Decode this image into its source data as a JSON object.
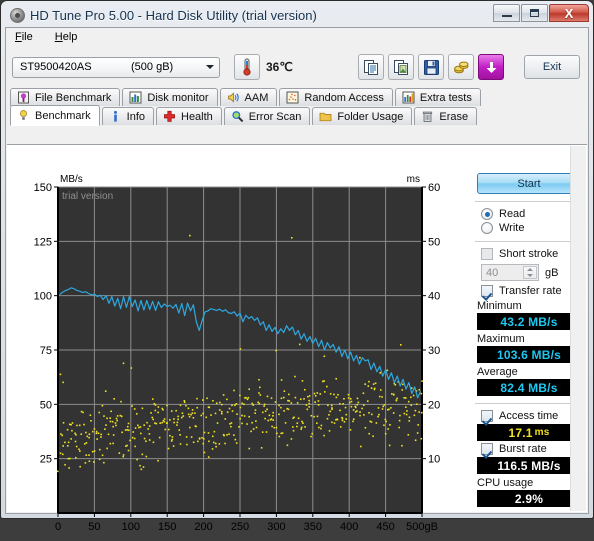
{
  "window": {
    "title": "HD Tune Pro 5.00 - Hard Disk Utility (trial version)",
    "icon": "hdd-icon",
    "minimize_label": "Minimize",
    "maximize_label": "Maximize",
    "close_label": "X"
  },
  "menu": {
    "items": [
      {
        "label": "File",
        "mnemonic": "F"
      },
      {
        "label": "Help",
        "mnemonic": "H"
      }
    ]
  },
  "toolbar": {
    "drive_model": "ST9500420AS",
    "drive_capacity": "(500 gB)",
    "temperature": "36℃",
    "temp_icon": "thermometer-icon",
    "buttons": [
      {
        "name": "copy-button",
        "icon": "copy-icon"
      },
      {
        "name": "copy-image-button",
        "icon": "copy-image-icon"
      },
      {
        "name": "save-button",
        "icon": "floppy-save-icon"
      },
      {
        "name": "options-button",
        "icon": "gold-coins-icon"
      },
      {
        "name": "download-button",
        "icon": "download-arrow-icon"
      }
    ],
    "exit_label": "Exit"
  },
  "tabs": {
    "row1": [
      {
        "label": "File Benchmark",
        "icon": "file-benchmark-icon",
        "active": false
      },
      {
        "label": "Disk monitor",
        "icon": "bar-chart-icon",
        "active": false
      },
      {
        "label": "AAM",
        "icon": "speaker-icon",
        "active": false
      },
      {
        "label": "Random Access",
        "icon": "random-access-icon",
        "active": false
      },
      {
        "label": "Extra tests",
        "icon": "extra-tests-icon",
        "active": false
      }
    ],
    "row2": [
      {
        "label": "Benchmark",
        "icon": "benchmark-bulb-icon",
        "active": true
      },
      {
        "label": "Info",
        "icon": "info-icon",
        "active": false
      },
      {
        "label": "Health",
        "icon": "health-cross-icon",
        "active": false
      },
      {
        "label": "Error Scan",
        "icon": "magnifier-icon",
        "active": false
      },
      {
        "label": "Folder Usage",
        "icon": "folder-icon",
        "active": false
      },
      {
        "label": "Erase",
        "icon": "trash-icon",
        "active": false
      }
    ]
  },
  "sidebar": {
    "start_label": "Start",
    "mode": {
      "read_label": "Read",
      "write_label": "Write",
      "selected": "Read"
    },
    "short_stroke": {
      "label": "Short stroke",
      "checked": false,
      "value": "40",
      "unit": "gB"
    },
    "transfer_rate": {
      "label": "Transfer rate",
      "checked": true
    },
    "minimum_label": "Minimum",
    "minimum_value": "43.2 MB/s",
    "maximum_label": "Maximum",
    "maximum_value": "103.6 MB/s",
    "average_label": "Average",
    "average_value": "82.4 MB/s",
    "access_time": {
      "label": "Access time",
      "checked": true,
      "value": "17.1",
      "unit": "ms"
    },
    "burst_rate": {
      "label": "Burst rate",
      "checked": true,
      "value": "116.5 MB/s"
    },
    "cpu_usage_label": "CPU usage",
    "cpu_usage_value": "2.9%"
  },
  "chart_data": {
    "type": "line",
    "title": "",
    "watermark": "trial version",
    "ylabel_left": "MB/s",
    "ylabel_right": "ms",
    "xlabel": "",
    "x_ticks": [
      "0",
      "50",
      "100",
      "150",
      "200",
      "250",
      "300",
      "350",
      "400",
      "450",
      "500gB"
    ],
    "x_tick_values": [
      0,
      50,
      100,
      150,
      200,
      250,
      300,
      350,
      400,
      450,
      500
    ],
    "xlim": [
      0,
      500
    ],
    "y_left_ticks": [
      "150",
      "125",
      "100",
      "75",
      "50",
      "25"
    ],
    "y_left_tick_values": [
      150,
      125,
      100,
      75,
      50,
      25
    ],
    "ylim_left": [
      0,
      150
    ],
    "y_right_ticks": [
      "60",
      "50",
      "40",
      "30",
      "20",
      "10"
    ],
    "y_right_tick_values": [
      60,
      50,
      40,
      30,
      20,
      10
    ],
    "ylim_right": [
      0,
      60
    ],
    "grid": true,
    "plot_bg": "#333333",
    "grid_color": "#8d8d8d",
    "series": [
      {
        "name": "Transfer rate",
        "type": "line",
        "color": "#2ea8e0",
        "axis": "left",
        "x": [
          2,
          6,
          10,
          14,
          18,
          22,
          26,
          30,
          34,
          38,
          42,
          46,
          50,
          54,
          58,
          62,
          66,
          70,
          74,
          78,
          82,
          86,
          90,
          94,
          98,
          102,
          106,
          110,
          114,
          118,
          122,
          126,
          130,
          134,
          138,
          142,
          146,
          150,
          154,
          158,
          162,
          166,
          170,
          174,
          178,
          182,
          186,
          190,
          194,
          198,
          202,
          206,
          210,
          214,
          218,
          222,
          226,
          230,
          234,
          238,
          242,
          246,
          250,
          254,
          258,
          262,
          266,
          270,
          274,
          278,
          282,
          286,
          290,
          294,
          298,
          302,
          306,
          310,
          314,
          318,
          322,
          326,
          330,
          334,
          338,
          342,
          346,
          350,
          354,
          358,
          362,
          366,
          370,
          374,
          378,
          382,
          386,
          390,
          394,
          398,
          402,
          406,
          410,
          414,
          418,
          422,
          426,
          430,
          434,
          438,
          442,
          446,
          450,
          454,
          458,
          462,
          466,
          470,
          474,
          478,
          482,
          486,
          490,
          494,
          498
        ],
        "y": [
          100.5,
          101.5,
          102.3,
          102.8,
          103.6,
          103.2,
          102.4,
          102.0,
          101.5,
          101.8,
          101.0,
          100.4,
          100.7,
          99.6,
          100.2,
          98.2,
          100.0,
          96.5,
          99.6,
          95.2,
          98.8,
          94.0,
          99.5,
          94.6,
          99.6,
          95.0,
          98.0,
          93.0,
          97.8,
          93.4,
          97.8,
          93.6,
          97.4,
          93.2,
          97.2,
          94.5,
          96.2,
          95.0,
          95.6,
          94.2,
          96.0,
          92.0,
          96.4,
          90.8,
          96.6,
          93.0,
          95.8,
          88.0,
          84.0,
          88.5,
          92.5,
          93.0,
          94.0,
          93.6,
          93.2,
          93.8,
          92.8,
          93.5,
          92.2,
          91.8,
          92.6,
          90.6,
          92.0,
          88.0,
          91.0,
          89.5,
          90.4,
          88.6,
          89.8,
          86.5,
          88.0,
          84.0,
          86.6,
          83.5,
          85.4,
          82.5,
          84.8,
          83.0,
          86.2,
          84.0,
          85.6,
          82.0,
          84.0,
          80.0,
          82.5,
          79.0,
          81.2,
          78.0,
          80.4,
          76.5,
          79.5,
          75.0,
          78.4,
          76.0,
          77.6,
          74.0,
          76.5,
          72.0,
          75.0,
          71.0,
          74.0,
          70.0,
          72.5,
          68.5,
          71.5,
          70.0,
          70.5,
          66.0,
          69.0,
          65.0,
          67.5,
          63.0,
          66.0,
          61.5,
          64.5,
          60.0,
          63.0,
          58.5,
          61.5,
          57.0,
          60.0,
          55.0,
          58.0,
          53.0,
          56.0,
          50.0,
          43.2
        ]
      },
      {
        "name": "Access time",
        "type": "scatter",
        "color": "#f2e31d",
        "axis": "right",
        "point_count": 520,
        "trend_note": "Access times rise from ~11 ms near LBA 0 to ~20 ms near the end of the drive, with heavy scatter between 8 and 31 ms.",
        "trend_start_ms": 11.5,
        "trend_end_ms": 20.5,
        "scatter_spread_ms": 5.5
      }
    ],
    "outliers": [
      {
        "x": 180,
        "y_left": 128,
        "color": "#f2e31d"
      },
      {
        "x": 320,
        "y_left": 127,
        "color": "#f2e31d"
      }
    ]
  }
}
